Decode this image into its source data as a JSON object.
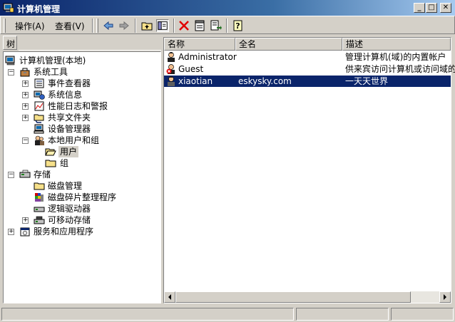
{
  "window": {
    "title": "计算机管理"
  },
  "menu": {
    "action": "操作(A)",
    "view": "查看(V)"
  },
  "toolbar_icons": [
    "back-arrow-icon",
    "forward-arrow-icon",
    "up-folder-icon",
    "show-hide-tree-icon",
    "delete-icon",
    "properties-icon",
    "export-list-icon",
    "help-icon"
  ],
  "tree_tab": {
    "label": "树"
  },
  "tree": {
    "root": "计算机管理(本地)",
    "system_tools": "系统工具",
    "event_viewer": "事件查看器",
    "system_info": "系统信息",
    "perf_logs": "性能日志和警报",
    "shared_folders": "共享文件夹",
    "device_manager": "设备管理器",
    "local_users_groups": "本地用户和组",
    "users": "用户",
    "groups": "组",
    "storage": "存储",
    "disk_mgmt": "磁盘管理",
    "defrag": "磁盘碎片整理程序",
    "logical_drives": "逻辑驱动器",
    "removable_storage": "可移动存储",
    "services_apps": "服务和应用程序"
  },
  "list": {
    "columns": [
      "名称",
      "全名",
      "描述"
    ],
    "rows": [
      {
        "name": "Administrator",
        "fullname": "",
        "desc": "管理计算机(域)的内置帐户"
      },
      {
        "name": "Guest",
        "fullname": "",
        "desc": "供来宾访问计算机或访问域的"
      },
      {
        "name": "xiaotian",
        "fullname": "eskysky.com",
        "desc": "一天天世界"
      }
    ],
    "selected_index": 2
  },
  "status": {
    "text": ""
  }
}
